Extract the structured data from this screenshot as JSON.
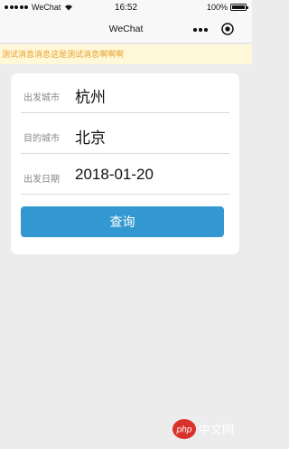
{
  "status_bar": {
    "carrier": "WeChat",
    "time": "16:52",
    "battery": "100%",
    "battery_level": 1.0
  },
  "nav": {
    "title": "WeChat"
  },
  "notice": {
    "text": "测试消息消息这是测试消息啊啊啊"
  },
  "form": {
    "departure_city": {
      "label": "出发城市",
      "value": "杭州"
    },
    "arrival_city": {
      "label": "目的城市",
      "value": "北京"
    },
    "departure_date": {
      "label": "出发日期",
      "value": "2018-01-20"
    },
    "search_label": "查询"
  },
  "watermark": {
    "text": "php 中文网"
  },
  "colors": {
    "button": "#3498d0",
    "notice_bg": "#fff8d8",
    "notice_text": "#e89e2e",
    "page_bg": "#ececec"
  }
}
